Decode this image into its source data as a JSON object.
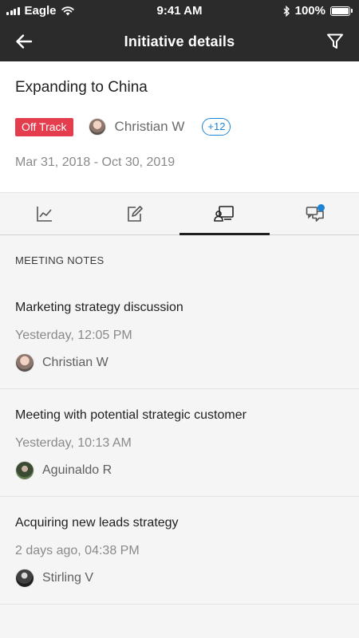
{
  "status_bar": {
    "carrier": "Eagle",
    "time": "9:41 AM",
    "battery": "100%",
    "battery_level": 1.0
  },
  "header": {
    "title": "Initiative details",
    "back_icon": "arrow-left-icon",
    "filter_icon": "filter-icon"
  },
  "initiative": {
    "title": "Expanding to China",
    "status": "Off Track",
    "status_color": "#e33d4e",
    "owner": "Christian W",
    "more_members": "+12",
    "dates": "Mar 31, 2018 - Oct 30, 2019"
  },
  "tabs": [
    {
      "icon": "chart-icon",
      "active": false
    },
    {
      "icon": "edit-icon",
      "active": false
    },
    {
      "icon": "meeting-notes-icon",
      "active": true
    },
    {
      "icon": "comments-icon",
      "active": false,
      "has_notification": true
    }
  ],
  "section_label": "MEETING NOTES",
  "notes": [
    {
      "title": "Marketing strategy discussion",
      "time": "Yesterday, 12:05 PM",
      "author": "Christian W"
    },
    {
      "title": "Meeting with potential strategic customer",
      "time": "Yesterday, 10:13 AM",
      "author": "Aguinaldo R"
    },
    {
      "title": "Acquiring new leads strategy",
      "time": "2 days ago, 04:38 PM",
      "author": "Stirling V"
    }
  ],
  "colors": {
    "header_bg": "#2b2b2b",
    "accent_blue": "#1d84d5"
  }
}
